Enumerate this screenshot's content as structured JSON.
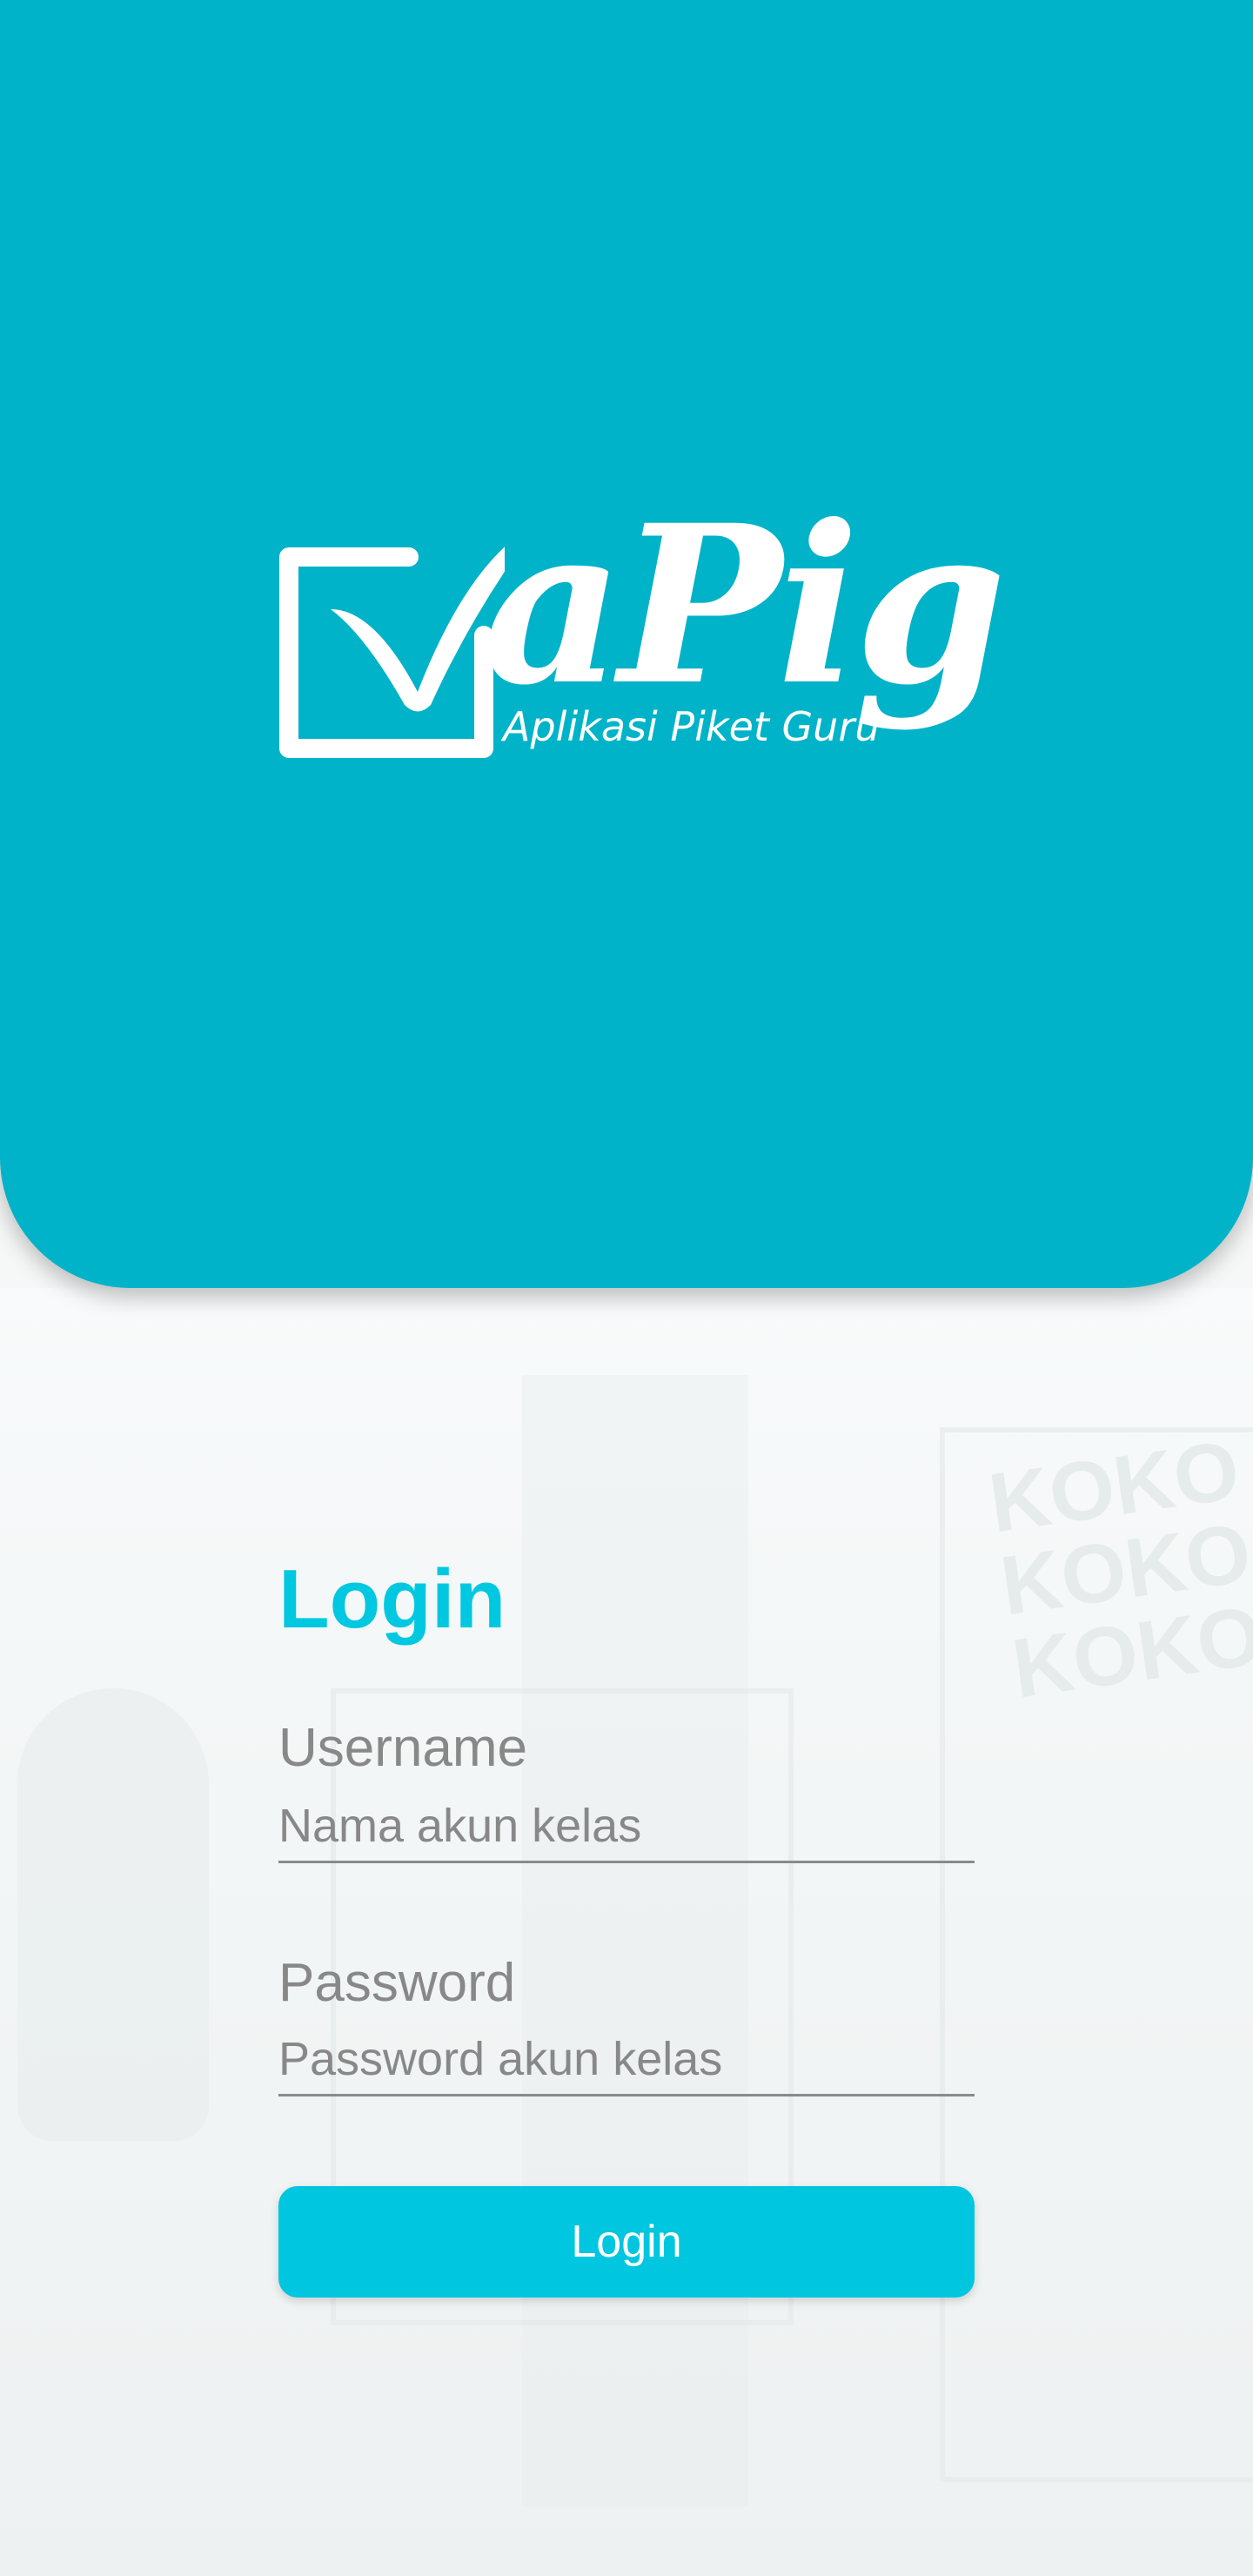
{
  "brand": {
    "logo_word": "aPig",
    "tagline": "Aplikasi Piket Guru",
    "header_color": "#00b3c8",
    "accent_color": "#00c6e0"
  },
  "login_form": {
    "title": "Login",
    "username": {
      "label": "Username",
      "placeholder": "Nama akun kelas",
      "value": ""
    },
    "password": {
      "label": "Password",
      "placeholder": "Password akun kelas",
      "value": ""
    },
    "submit_label": "Login"
  }
}
